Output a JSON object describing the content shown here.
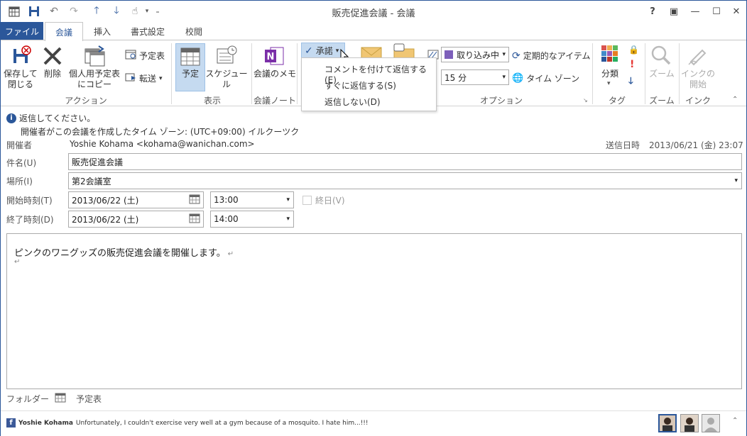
{
  "window": {
    "title": "販売促進会議 - 会議"
  },
  "quick_access": {
    "icons": [
      "calendar-icon",
      "save-icon",
      "undo-icon",
      "redo-icon",
      "up-arrow-icon",
      "down-arrow-icon",
      "touch-mode-icon",
      "customize-icon"
    ]
  },
  "window_controls": {
    "help": "?",
    "restore_ribbon": "▣",
    "minimize": "—",
    "maximize": "☐",
    "close": "✕"
  },
  "tabs": {
    "file": "ファイル",
    "meeting": "会議",
    "insert": "挿入",
    "format": "書式設定",
    "review": "校閲"
  },
  "ribbon": {
    "action": {
      "label": "アクション",
      "save_close_1": "保存して",
      "save_close_2": "閉じる",
      "delete": "削除",
      "copy_1": "個人用予定表",
      "copy_2": "にコピー",
      "calendar": "予定表",
      "forward": "転送"
    },
    "display": {
      "label": "表示",
      "appointment": "予定",
      "schedule": "スケジュール"
    },
    "meeting_notes": {
      "label": "会議ノート",
      "notes": "会議のメモ"
    },
    "respond": {
      "accept": "承諾"
    },
    "options": {
      "label": "オプション",
      "show_as": "取り込み中",
      "recurrence": "定期的なアイテム",
      "reminder": "15 分",
      "time_zone": "タイム ゾーン"
    },
    "tags": {
      "label": "タグ",
      "categorize": "分類"
    },
    "zoom": {
      "label": "ズーム",
      "zoom": "ズーム"
    },
    "ink": {
      "label": "インク",
      "start_1": "インクの",
      "start_2": "開始"
    }
  },
  "accept_menu": {
    "items": [
      "コメントを付けて返信する(E)",
      "すぐに返信する(S)",
      "返信しない(D)"
    ]
  },
  "info": {
    "line1": "返信してください。",
    "line2": "開催者がこの会議を作成したタイム ゾーン: (UTC+09:00) イルクーツク"
  },
  "form": {
    "organizer_label": "開催者",
    "organizer_value": "Yoshie Kohama <kohama@wanichan.com>",
    "sent_label": "送信日時",
    "sent_value": "2013/06/21 (金) 23:07",
    "subject_label": "件名(U)",
    "subject_value": "販売促進会議",
    "location_label": "場所(I)",
    "location_value": "第2会議室",
    "start_label": "開始時刻(T)",
    "start_date": "2013/06/22 (土)",
    "start_time": "13:00",
    "allday_label": "終日(V)",
    "end_label": "終了時刻(D)",
    "end_date": "2013/06/22 (土)",
    "end_time": "14:00"
  },
  "body": {
    "line1": "ピンクのワニグッズの販売促進会議を開催します。",
    "line2": ""
  },
  "folder": {
    "label": "フォルダー",
    "value": "予定表"
  },
  "status": {
    "name": "Yoshie Kohama",
    "message": "Unfortunately, I couldn't exercise very well at a gym because of a mosquito. I hate him...!!!"
  },
  "colors": {
    "accent": "#2b579a",
    "busy": "#7d5fba",
    "onenote": "#7b2fa8",
    "selected": "#c5daf0"
  }
}
